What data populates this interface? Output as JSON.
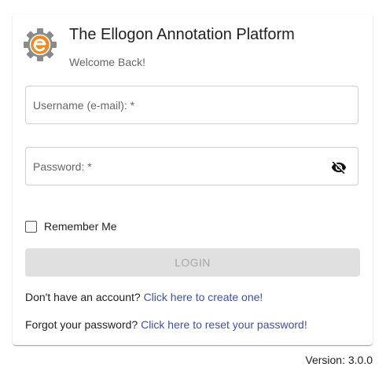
{
  "header": {
    "title": "The Ellogon Annotation Platform",
    "subtitle": "Welcome Back!",
    "logo_icon": "ellogon-gear-logo-icon"
  },
  "form": {
    "username_label": "Username (e-mail): *",
    "username_value": "",
    "password_label": "Password: *",
    "password_value": "",
    "password_toggle_icon": "eye-off-icon",
    "remember_label": "Remember Me",
    "remember_checked": false,
    "login_label": "LOGIN",
    "login_disabled": true
  },
  "links": {
    "create_prompt": "Don't have an account?",
    "create_link": "Click here to create one!",
    "reset_prompt": "Forgot your password?",
    "reset_link": "Click here to reset your password!"
  },
  "footer": {
    "version": "Version: 3.0.0"
  },
  "colors": {
    "link": "#3d4fb0",
    "logo_orange": "#f08a1c",
    "logo_gray": "#8a8a8a",
    "button_disabled_bg": "#e0e0e0",
    "button_disabled_text": "#a6a6a6"
  }
}
